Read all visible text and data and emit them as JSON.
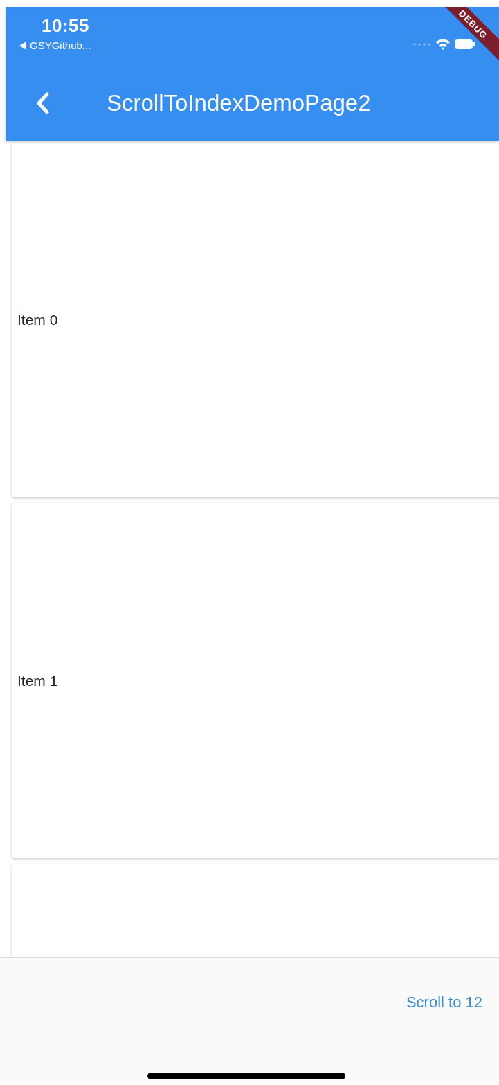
{
  "status_bar": {
    "time": "10:55",
    "back_app": "GSYGithub..."
  },
  "debug_banner": "DEBUG",
  "app_bar": {
    "title": "ScrollToIndexDemoPage2"
  },
  "cards": [
    {
      "label": "Item 0"
    },
    {
      "label": "Item 1"
    }
  ],
  "partial_card_below": true,
  "bottom_bar": {
    "button": "Scroll to 12"
  }
}
